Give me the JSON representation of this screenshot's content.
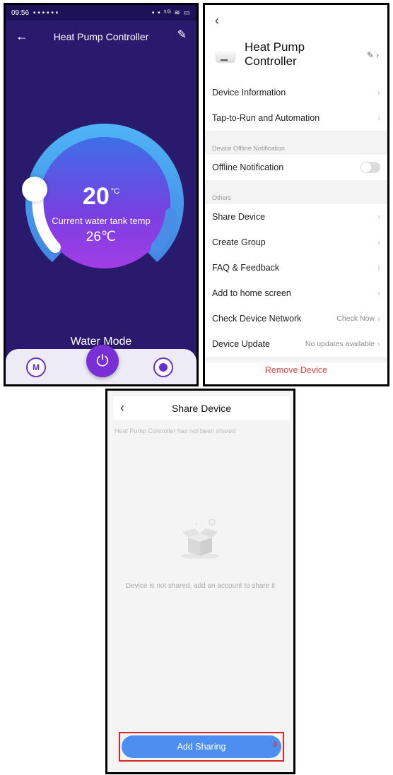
{
  "screen1": {
    "status_time": "09:56",
    "status_icons": "▪ ▪ ▪ ▪ ▪ ▪",
    "status_right": "▪ ▪ ⁵ᴳ ≋ ▭",
    "title": "Heat Pump Controller",
    "set_temp": "20",
    "set_temp_unit": "°C",
    "temp_label": "Current water tank temp",
    "current_temp": "26℃",
    "mode": "Water Mode",
    "btn_m": "M",
    "power_icon": "⏻",
    "colors": {
      "background": "#2a1a6e",
      "accent": "#7a2fd6"
    }
  },
  "screen2": {
    "back": "‹",
    "device_name": "Heat Pump Controller",
    "items": {
      "device_info": "Device Information",
      "tap_to_run": "Tap-to-Run and Automation",
      "offline_section": "Device Offline Notification",
      "offline_notification": "Offline Notification",
      "others_section": "Others",
      "share": "Share Device",
      "create_group": "Create Group",
      "faq": "FAQ & Feedback",
      "home_screen": "Add to home screen",
      "check_network": "Check Device Network",
      "check_network_value": "Check Now",
      "device_update": "Device Update",
      "device_update_value": "No updates available",
      "remove": "Remove Device"
    },
    "offline_toggle_on": false
  },
  "screen3": {
    "back": "‹",
    "title": "Share Device",
    "notice": "Heat Pump Controller has not been shared",
    "empty": "Device is not shared, add an account to share it",
    "add_button": "Add Sharing",
    "step": "3"
  }
}
